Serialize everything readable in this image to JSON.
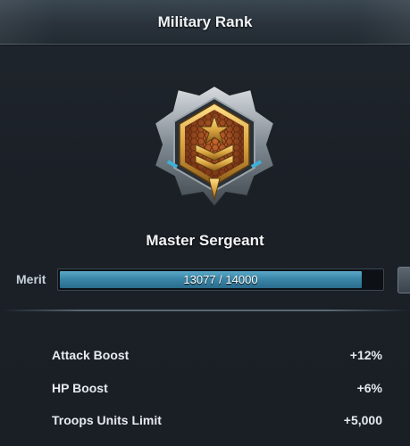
{
  "window": {
    "title": "Military Rank"
  },
  "rank": {
    "name": "Master Sergeant",
    "emblem": "master-sergeant-rank-emblem"
  },
  "merit": {
    "label": "Merit",
    "current": 13077,
    "max": 14000,
    "progress_text": "13077 / 14000",
    "fill_color": "#3a86a8"
  },
  "stats": [
    {
      "label": "Attack Boost",
      "value": "+12%"
    },
    {
      "label": "HP Boost",
      "value": "+6%"
    },
    {
      "label": "Troops Units Limit",
      "value": "+5,000"
    }
  ],
  "colors": {
    "emblem_gold": "#d9a441",
    "emblem_bronze": "#a04e22",
    "emblem_accent": "#3fb0d8"
  }
}
